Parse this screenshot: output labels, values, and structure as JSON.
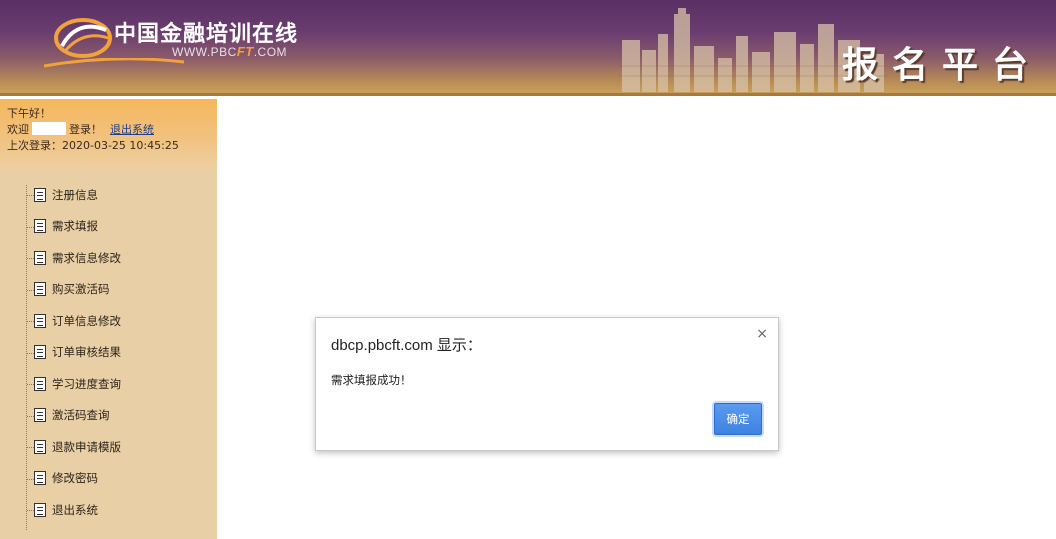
{
  "header": {
    "logo_title": "中国金融培训在线",
    "logo_url_prefix": "WWW.PBC",
    "logo_url_ft": "FT",
    "logo_url_suffix": ".COM",
    "platform_title": "报名平台",
    "logo_icon": "swoosh-logo-icon",
    "skyline_image": "city-skyline"
  },
  "user": {
    "greeting": "下午好！",
    "welcome_prefix": "欢迎",
    "welcome_suffix": "登录！",
    "logout_label": "退出系统",
    "last_login": "上次登录：2020-03-25 10:45:25"
  },
  "menu": {
    "icon": "document-icon",
    "items": [
      {
        "label": "注册信息"
      },
      {
        "label": "需求填报"
      },
      {
        "label": "需求信息修改"
      },
      {
        "label": "购买激活码"
      },
      {
        "label": "订单信息修改"
      },
      {
        "label": "订单审核结果"
      },
      {
        "label": "学习进度查询"
      },
      {
        "label": "激活码查询"
      },
      {
        "label": "退款申请模版"
      },
      {
        "label": "修改密码"
      },
      {
        "label": "退出系统"
      }
    ]
  },
  "dialog": {
    "title": "dbcp.pbcft.com 显示：",
    "close": "×",
    "message": "需求填报成功！",
    "ok_label": "确定"
  },
  "colors": {
    "header_purple": "#5a2f63",
    "header_gold": "#c9a05a",
    "sidebar_bg": "#e8cfa6",
    "userbox_orange": "#f5b75c",
    "button_blue": "#3f82e0",
    "logo_orange": "#f2a23b"
  }
}
